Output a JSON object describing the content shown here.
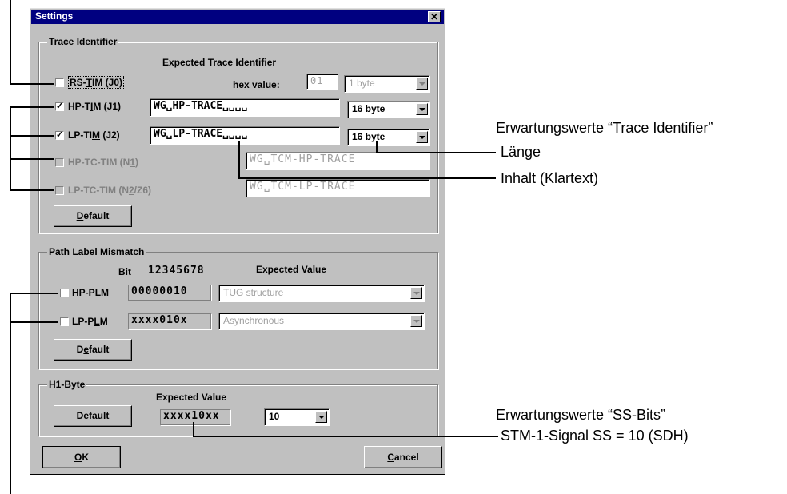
{
  "dialog": {
    "title": "Settings",
    "close_glyph": "✕"
  },
  "trace": {
    "legend": "Trace Identifier",
    "expected_header": "Expected Trace Identifier",
    "hex_label": "hex value:",
    "hex_value": "01",
    "rows": [
      {
        "label": "RS-TIM (J0)",
        "checked": false,
        "enabled": true
      },
      {
        "label": "HP-TIM (J1)",
        "checked": true,
        "enabled": true,
        "value": "WG␣HP-TRACE␣␣␣␣",
        "length": "16 byte"
      },
      {
        "label": "LP-TIM (J2)",
        "checked": true,
        "enabled": true,
        "value": "WG␣LP-TRACE␣␣␣␣",
        "length": "16 byte"
      },
      {
        "label": "HP-TC-TIM (N1)",
        "checked": false,
        "enabled": false,
        "value": "WG␣TCM-HP-TRACE"
      },
      {
        "label": "LP-TC-TIM (N2/Z6)",
        "checked": false,
        "enabled": false,
        "value": "WG␣TCM-LP-TRACE"
      }
    ],
    "rs_length": "1 byte",
    "default_label": "Default"
  },
  "plm": {
    "legend": "Path Label Mismatch",
    "bit_label": "Bit",
    "bit_numbers": "12345678",
    "expected_header": "Expected Value",
    "rows": [
      {
        "label": "HP-PLM",
        "checked": false,
        "bits": "00000010",
        "value": "TUG structure"
      },
      {
        "label": "LP-PLM",
        "checked": false,
        "bits": "xxxx010x",
        "value": "Asynchronous"
      }
    ],
    "default_label": "Default"
  },
  "h1": {
    "legend": "H1-Byte",
    "expected_header": "Expected Value",
    "bits": "xxxx10xx",
    "value": "10",
    "default_label": "Default"
  },
  "footer": {
    "ok_label": "OK",
    "cancel_label": "Cancel"
  },
  "annotations": {
    "trace_title": "Erwartungswerte “Trace Identifier”",
    "length": "Länge",
    "content": "Inhalt (Klartext)",
    "ss_title": "Erwartungswerte “SS-Bits”",
    "ss_detail": "STM-1-Signal SS = 10 (SDH)"
  },
  "colors": {
    "titlebar": "#000080",
    "face": "#c0c0c0",
    "disabled": "#a0a0a0"
  }
}
